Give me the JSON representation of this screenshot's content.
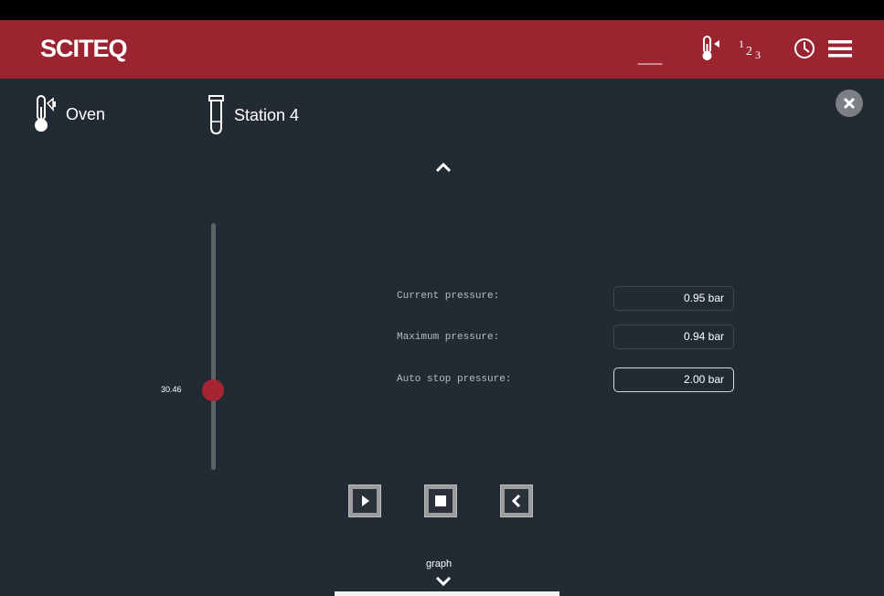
{
  "header": {
    "brand": "SCITEQ",
    "status_text": "---------",
    "icons": [
      "thermometer-icon",
      "sequence-123-icon",
      "clock-icon",
      "menu-icon"
    ],
    "colors": {
      "bar": "#9b2431",
      "background": "#222a33",
      "accent": "#a52632"
    }
  },
  "devices": [
    {
      "label": "Oven",
      "icon": "thermometer-speaker-icon"
    },
    {
      "label": "Station 4",
      "icon": "tube-icon"
    }
  ],
  "slider": {
    "value_label": "30.46"
  },
  "readings": {
    "current_label": "Current pressure:",
    "current_value": "0.95 bar",
    "maximum_label": "Maximum pressure:",
    "maximum_value": "0.94 bar",
    "auto_stop_label": "Auto stop pressure:",
    "auto_stop_value": "2.00 bar"
  },
  "controls": [
    "play-icon",
    "stop-icon",
    "back-icon"
  ],
  "footer": {
    "graph_label": "graph"
  }
}
